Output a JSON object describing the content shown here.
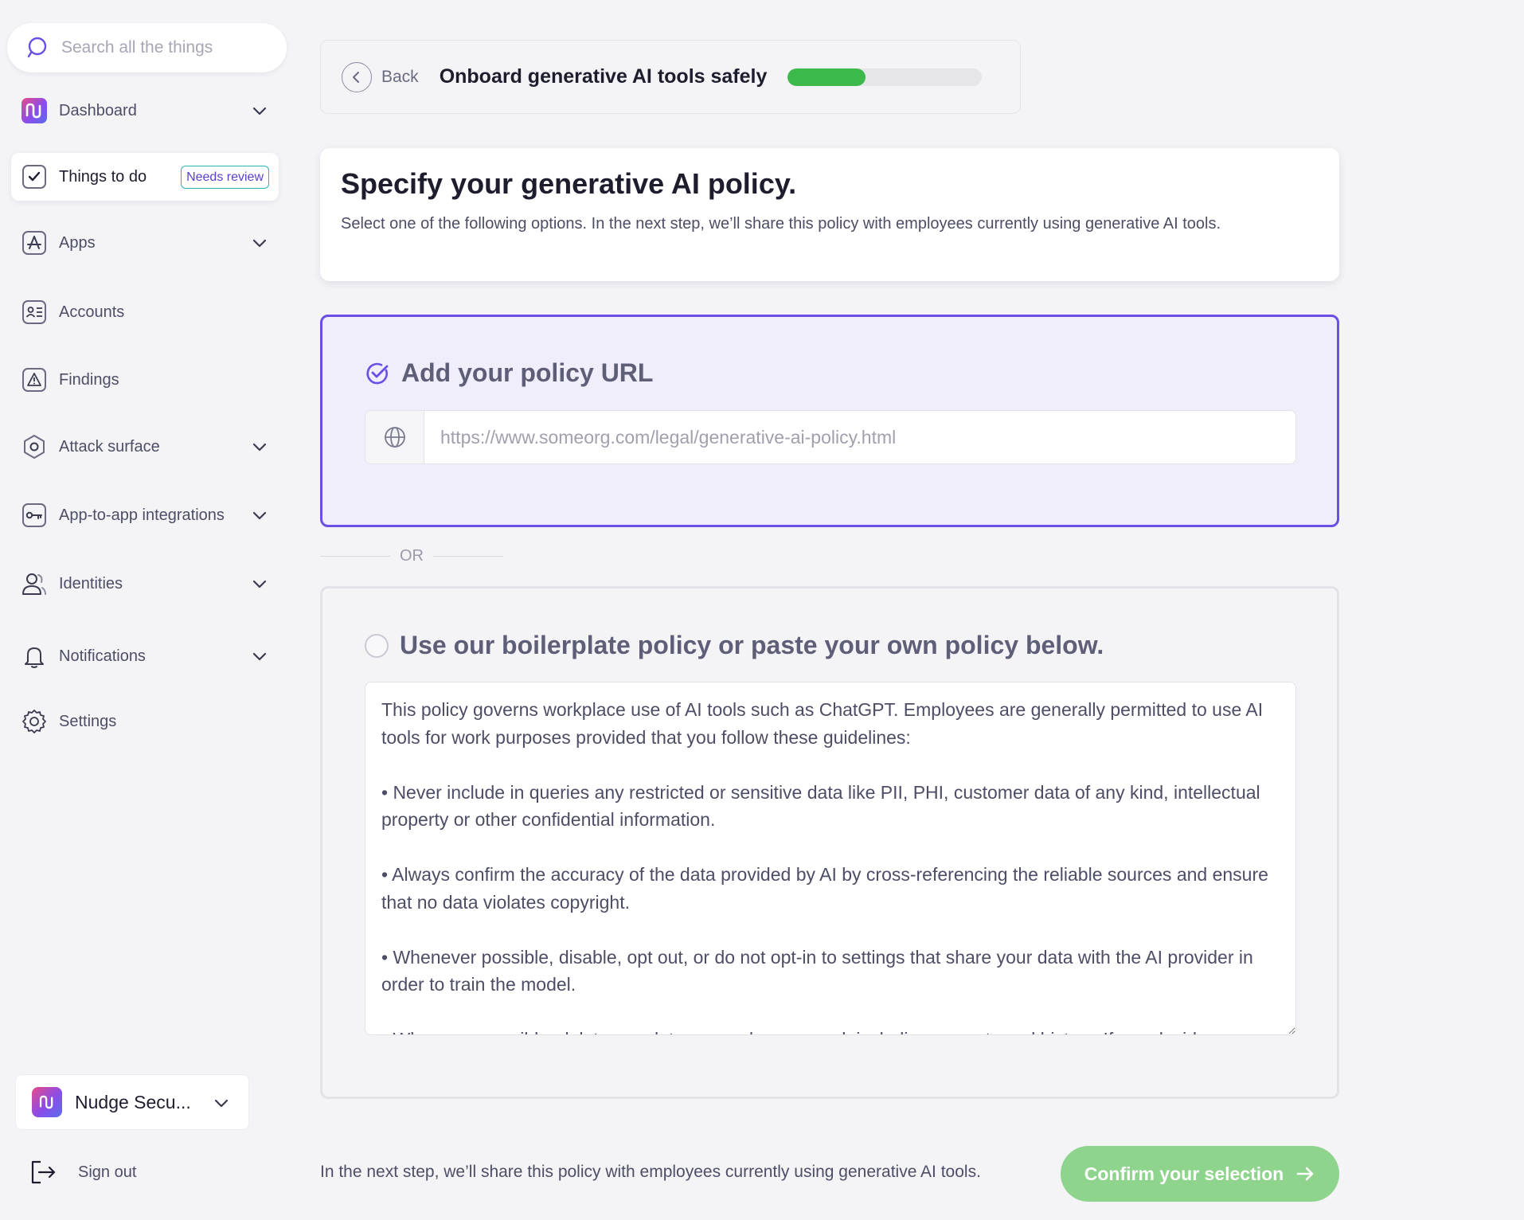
{
  "search": {
    "placeholder": "Search all the things"
  },
  "sidebar": {
    "items": [
      {
        "label": "Dashboard",
        "icon": "nudge-logo-icon",
        "expandable": true
      },
      {
        "label": "Things to do",
        "icon": "checkbox-icon",
        "badge": "Needs review",
        "active": true
      },
      {
        "label": "Apps",
        "icon": "apps-icon",
        "expandable": true
      },
      {
        "label": "Accounts",
        "icon": "id-card-icon"
      },
      {
        "label": "Findings",
        "icon": "warning-icon"
      },
      {
        "label": "Attack surface",
        "icon": "hexagon-icon",
        "expandable": true
      },
      {
        "label": "App-to-app integrations",
        "icon": "key-icon",
        "expandable": true
      },
      {
        "label": "Identities",
        "icon": "users-icon",
        "expandable": true
      },
      {
        "label": "Notifications",
        "icon": "bell-icon",
        "expandable": true
      },
      {
        "label": "Settings",
        "icon": "gear-icon"
      }
    ],
    "org_name": "Nudge Secu...",
    "signout_label": "Sign out"
  },
  "topbar": {
    "back_label": "Back",
    "title": "Onboard generative AI tools safely",
    "progress": 0.4
  },
  "header": {
    "title": "Specify your generative AI policy.",
    "subtitle": "Select one of the following options. In the next step, we’ll share this policy with employees currently using generative AI tools."
  },
  "option_url": {
    "title": "Add your policy URL",
    "selected": true,
    "placeholder": "https://www.someorg.com/legal/generative-ai-policy.html"
  },
  "divider": {
    "label": "OR"
  },
  "option_boilerplate": {
    "title": "Use our boilerplate policy or paste your own policy below.",
    "selected": false,
    "text": "This policy governs workplace use of AI tools such as ChatGPT. Employees are generally permitted to use AI tools for work purposes provided that you follow these guidelines:\n\n• Never include in queries any restricted or sensitive data like PII, PHI, customer data of any kind, intellectual property or other confidential information.\n\n• Always confirm the accuracy of the data provided by AI by cross-referencing the reliable sources and ensure that no data violates copyright.\n\n• Whenever possible, disable, opt out, or do not opt-in to settings that share your data with the AI provider in order to train the model.\n\n• Whenever possible, delete any data you no longer need, including prompts and history. If you decide"
  },
  "footer": {
    "note": "In the next step, we’ll share this policy with employees currently using generative AI tools.",
    "confirm_label": "Confirm your selection"
  },
  "colors": {
    "accent": "#6b4ee6",
    "progress_fill": "#3db84a",
    "confirm_button": "#8fd48c",
    "badge_border": "#2ab3b3"
  }
}
